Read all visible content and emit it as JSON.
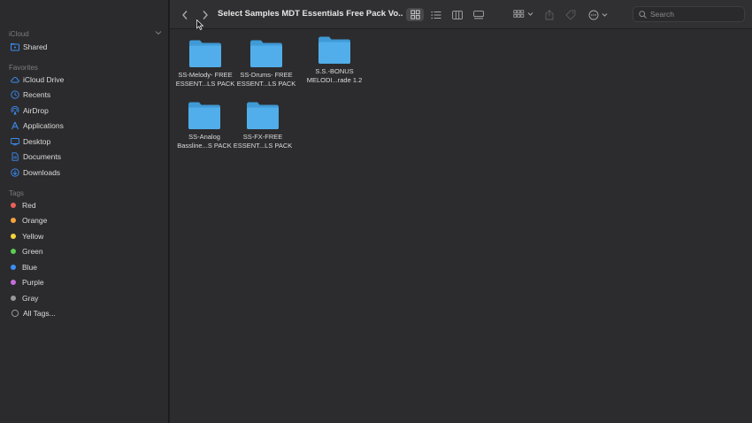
{
  "sidebar": {
    "icloud_title": "iCloud",
    "shared": "Shared",
    "favorites_title": "Favorites",
    "favorites": [
      {
        "label": "iCloud Drive",
        "icon": "cloud-icon"
      },
      {
        "label": "Recents",
        "icon": "clock-icon"
      },
      {
        "label": "AirDrop",
        "icon": "airdrop-icon"
      },
      {
        "label": "Applications",
        "icon": "applications-icon"
      },
      {
        "label": "Desktop",
        "icon": "desktop-icon"
      },
      {
        "label": "Documents",
        "icon": "document-icon"
      },
      {
        "label": "Downloads",
        "icon": "download-icon"
      }
    ],
    "tags_title": "Tags",
    "tags": [
      {
        "label": "Red",
        "color": "#ec5f58"
      },
      {
        "label": "Orange",
        "color": "#f5a33c"
      },
      {
        "label": "Yellow",
        "color": "#f6d23e"
      },
      {
        "label": "Green",
        "color": "#5ccd53"
      },
      {
        "label": "Blue",
        "color": "#3b8ef5"
      },
      {
        "label": "Purple",
        "color": "#c56ed9"
      },
      {
        "label": "Gray",
        "color": "#98989c"
      }
    ],
    "all_tags": "All Tags..."
  },
  "toolbar": {
    "title": "Select Samples MDT Essentials Free Pack Vo...",
    "search_placeholder": "Search"
  },
  "files": [
    {
      "line1": "SS-Melody- FREE",
      "line2": "ESSENT...LS PACK"
    },
    {
      "line1": "SS-Drums- FREE",
      "line2": "ESSENT...LS PACK"
    },
    {
      "line1": "S.S.-BONUS",
      "line2": "MELODI...rade 1.2"
    },
    {
      "line1": "SS-Analog",
      "line2": "Bassline...S PACK"
    },
    {
      "line1": "SS-FX-FREE",
      "line2": "ESSENT...LS PACK"
    }
  ],
  "colors": {
    "accent": "#3b8ef5",
    "folder": "#4ba6e8"
  }
}
